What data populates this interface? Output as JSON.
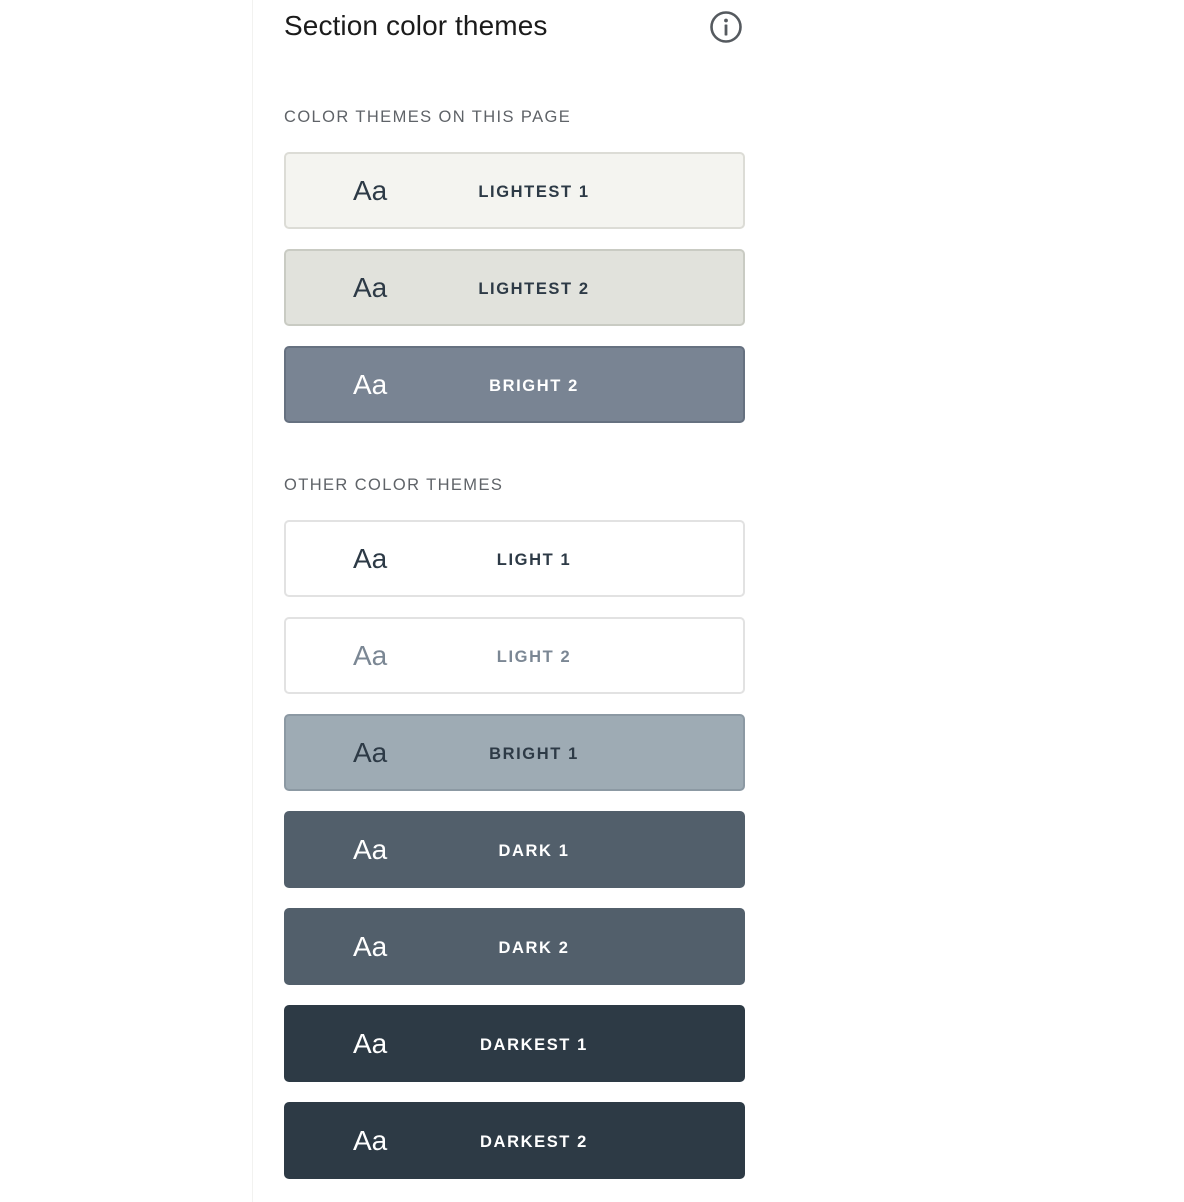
{
  "panel": {
    "title": "Section color themes",
    "info_icon": "info-circle-icon"
  },
  "page_themes": {
    "label": "COLOR THEMES ON THIS PAGE",
    "items": [
      {
        "sample": "Aa",
        "name": "LIGHTEST 1",
        "bg": "#f4f4f0",
        "border": "#dcdcd6",
        "fg": "#2d3a46"
      },
      {
        "sample": "Aa",
        "name": "LIGHTEST 2",
        "bg": "#e1e2dc",
        "border": "#c9cbc3",
        "fg": "#2d3a46"
      },
      {
        "sample": "Aa",
        "name": "BRIGHT 2",
        "bg": "#798493",
        "border": "#667180",
        "fg": "#ffffff"
      }
    ]
  },
  "other_themes": {
    "label": "OTHER COLOR THEMES",
    "items": [
      {
        "sample": "Aa",
        "name": "LIGHT 1",
        "bg": "#ffffff",
        "border": "#e2e2e2",
        "fg": "#2d3a46"
      },
      {
        "sample": "Aa",
        "name": "LIGHT 2",
        "bg": "#ffffff",
        "border": "#e2e2e2",
        "fg": "#7b8794"
      },
      {
        "sample": "Aa",
        "name": "BRIGHT 1",
        "bg": "#9eabb4",
        "border": "#8c99a3",
        "fg": "#2d3a46"
      },
      {
        "sample": "Aa",
        "name": "DARK 1",
        "bg": "#525f6b",
        "border": "#525f6b",
        "fg": "#ffffff"
      },
      {
        "sample": "Aa",
        "name": "DARK 2",
        "bg": "#525f6b",
        "border": "#525f6b",
        "fg": "#ffffff"
      },
      {
        "sample": "Aa",
        "name": "DARKEST 1",
        "bg": "#2d3a45",
        "border": "#2d3a45",
        "fg": "#ffffff"
      },
      {
        "sample": "Aa",
        "name": "DARKEST 2",
        "bg": "#2d3a45",
        "border": "#2d3a45",
        "fg": "#ffffff"
      }
    ]
  }
}
